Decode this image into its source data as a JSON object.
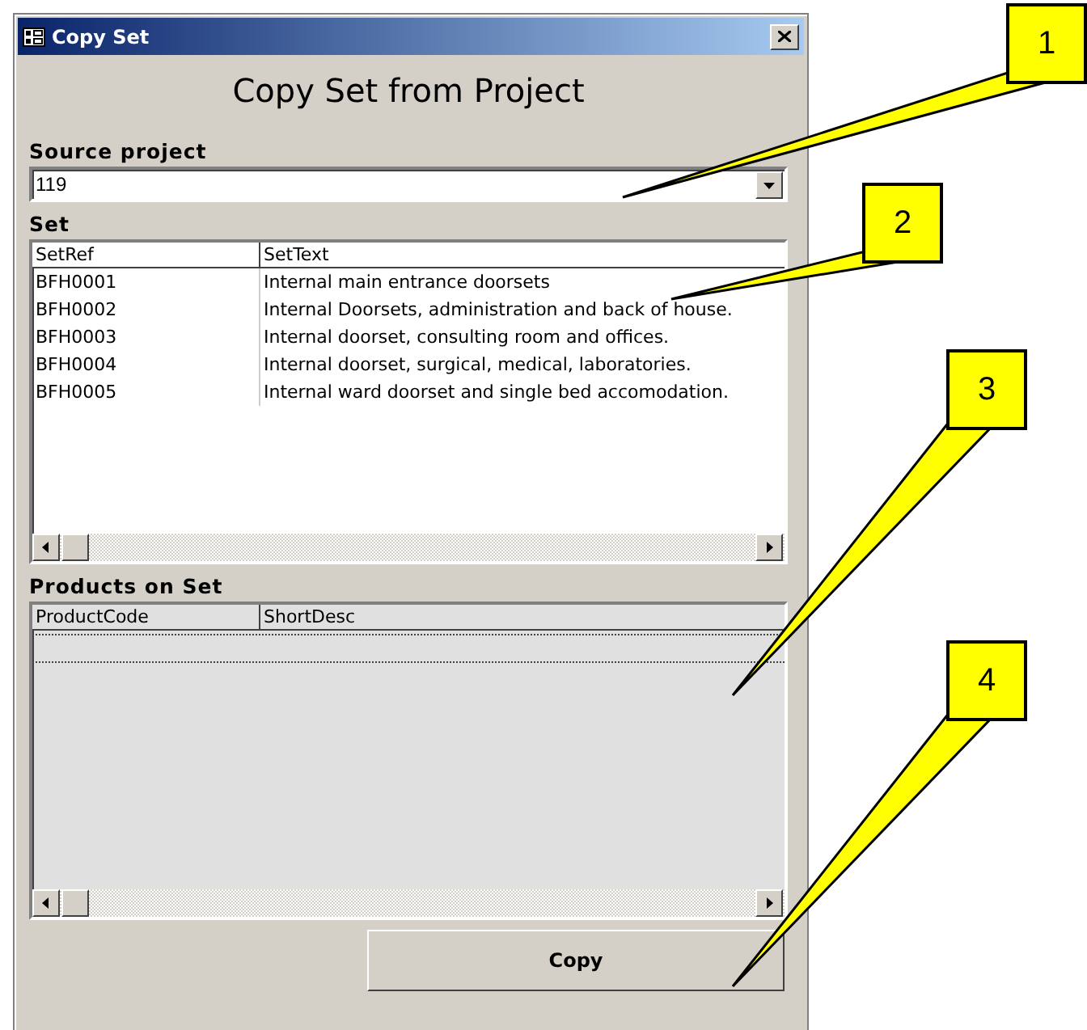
{
  "window": {
    "title": "Copy Set"
  },
  "heading": "Copy Set from Project",
  "source_project": {
    "label": "Source project",
    "value": "119"
  },
  "set": {
    "label": "Set",
    "columns": [
      "SetRef",
      "SetText"
    ],
    "rows": [
      [
        "BFH0001",
        "Internal main entrance doorsets"
      ],
      [
        "BFH0002",
        "Internal Doorsets, administration and back of house."
      ],
      [
        "BFH0003",
        "Internal doorset, consulting room and offices."
      ],
      [
        "BFH0004",
        "Internal doorset, surgical, medical, laboratories."
      ],
      [
        "BFH0005",
        "Internal ward doorset and single bed accomodation."
      ]
    ]
  },
  "products": {
    "label": "Products on Set",
    "columns": [
      "ProductCode",
      "ShortDesc"
    ]
  },
  "buttons": [
    "Copy"
  ],
  "callouts": [
    {
      "label": "1"
    },
    {
      "label": "2"
    },
    {
      "label": "3"
    },
    {
      "label": "4"
    }
  ]
}
